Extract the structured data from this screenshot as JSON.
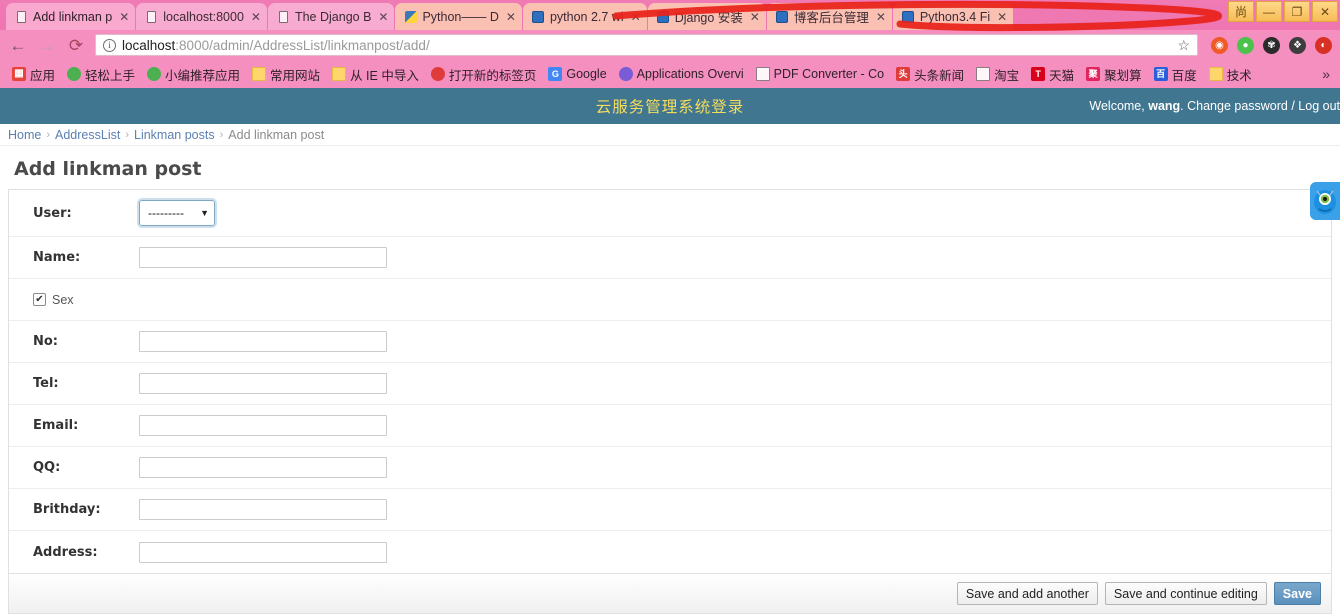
{
  "browser": {
    "tabs": [
      {
        "title": "Add linkman p",
        "favicon": "page-icon",
        "active": true
      },
      {
        "title": "localhost:8000",
        "favicon": "page-icon",
        "active": false
      },
      {
        "title": "The Django B",
        "favicon": "page-icon",
        "active": false
      },
      {
        "title": "Python—— D",
        "favicon": "python-icon",
        "active": false
      },
      {
        "title": "python 2.7 wi",
        "favicon": "app-icon",
        "active": false
      },
      {
        "title": "Django 安装",
        "favicon": "app-icon",
        "active": false
      },
      {
        "title": "博客后台管理",
        "favicon": "app-icon",
        "active": false
      },
      {
        "title": "Python3.4 Fi",
        "favicon": "app-icon",
        "active": false
      }
    ],
    "tab_close_glyph": "✕",
    "window_controls": [
      {
        "name": "shang-button",
        "glyph": "尚"
      },
      {
        "name": "minimize-button",
        "glyph": "—"
      },
      {
        "name": "maximize-button",
        "glyph": "❐"
      },
      {
        "name": "close-button",
        "glyph": "✕"
      }
    ],
    "nav": {
      "back_glyph": "←",
      "forward_glyph": "→",
      "reload_glyph": "⟳",
      "info_glyph": "i",
      "star_glyph": "☆",
      "url_host": "localhost",
      "url_path": ":8000/admin/AddressList/linkmanpost/add/",
      "url_full": "localhost:8000/admin/AddressList/linkmanpost/add/"
    },
    "extensions": [
      {
        "name": "owl-extension-icon",
        "glyph": "◉",
        "color": "#f05a28"
      },
      {
        "name": "green-dot-extension-icon",
        "glyph": "●",
        "color": "#4bc34b"
      },
      {
        "name": "gear-extension-icon",
        "glyph": "✾",
        "color": "#2b2b2b"
      },
      {
        "name": "evernote-extension-icon",
        "glyph": "❖",
        "color": "#3d3d3d"
      },
      {
        "name": "red-extension-icon",
        "glyph": "◐",
        "color": "#d93025"
      }
    ],
    "bookmarks": [
      {
        "label": "应用",
        "icon": "apps-grid-icon",
        "icon_type": "grid",
        "color": "#e8433a"
      },
      {
        "label": "轻松上手",
        "icon": "chrome-icon",
        "icon_type": "chrome",
        "color": "#4caf50"
      },
      {
        "label": "小编推荐应用",
        "icon": "chrome-icon",
        "icon_type": "chrome",
        "color": "#4caf50"
      },
      {
        "label": "常用网站",
        "icon": "folder-icon",
        "icon_type": "folder",
        "color": "#ffd66b"
      },
      {
        "label": "从 IE 中导入",
        "icon": "folder-icon",
        "icon_type": "folder",
        "color": "#ffd66b"
      },
      {
        "label": "打开新的标签页",
        "icon": "red-circle-icon",
        "icon_type": "circle",
        "color": "#e03b3b"
      },
      {
        "label": "Google",
        "icon": "google-icon",
        "icon_type": "letter",
        "glyph": "G",
        "color": "#4285f4"
      },
      {
        "label": "Applications Overvi",
        "icon": "firefox-icon",
        "icon_type": "circle",
        "color": "#7a5cd6"
      },
      {
        "label": "PDF Converter - Co",
        "icon": "pdf-icon",
        "icon_type": "doc",
        "color": "#f0a030"
      },
      {
        "label": "头条新闻",
        "icon": "toutiao-icon",
        "icon_type": "letter",
        "glyph": "头",
        "color": "#e03b3b"
      },
      {
        "label": "淘宝",
        "icon": "taobao-icon",
        "icon_type": "doc",
        "color": "#ff6a00"
      },
      {
        "label": "天猫",
        "icon": "tmall-icon",
        "icon_type": "letter",
        "glyph": "T",
        "color": "#d9001b"
      },
      {
        "label": "聚划算",
        "icon": "juhuasuan-icon",
        "icon_type": "letter",
        "glyph": "聚",
        "color": "#e0245e"
      },
      {
        "label": "百度",
        "icon": "baidu-icon",
        "icon_type": "letter",
        "glyph": "百",
        "color": "#2b5fd9"
      },
      {
        "label": "技术",
        "icon": "folder-icon",
        "icon_type": "folder",
        "color": "#ffd66b"
      }
    ],
    "bookmarks_overflow_glyph": "»"
  },
  "admin": {
    "branding": "云服务管理系统登录",
    "user_tools": {
      "welcome_prefix": "Welcome, ",
      "username": "wang",
      "suffix": ". Change password / Log out"
    },
    "breadcrumbs": [
      {
        "label": "Home",
        "link": true
      },
      {
        "label": "AddressList",
        "link": true
      },
      {
        "label": "Linkman posts",
        "link": true
      },
      {
        "label": "Add linkman post",
        "link": false
      }
    ],
    "breadcrumb_separator": "›",
    "page_title": "Add linkman post",
    "form": {
      "fields": [
        {
          "label": "User:",
          "type": "select",
          "value": "---------",
          "caret": "▼",
          "name": "user"
        },
        {
          "label": "Name:",
          "type": "text",
          "value": "",
          "name": "name"
        },
        {
          "label": "Sex",
          "type": "checkbox",
          "checked": true,
          "check_glyph": "✔",
          "name": "sex"
        },
        {
          "label": "No:",
          "type": "text",
          "value": "",
          "name": "no"
        },
        {
          "label": "Tel:",
          "type": "text",
          "value": "",
          "name": "tel"
        },
        {
          "label": "Email:",
          "type": "text",
          "value": "",
          "name": "email"
        },
        {
          "label": "QQ:",
          "type": "text",
          "value": "",
          "name": "qq"
        },
        {
          "label": "Brithday:",
          "type": "text",
          "value": "",
          "name": "brithday"
        },
        {
          "label": "Address:",
          "type": "text",
          "value": "",
          "name": "address"
        }
      ]
    },
    "submit_row": {
      "save_and_add_another": "Save and add another",
      "save_and_continue": "Save and continue editing",
      "save": "Save"
    },
    "floating_widget": {
      "name": "monster-assistant-icon",
      "color": "#3aa0e8"
    }
  },
  "colors": {
    "header_bg": "#417690",
    "branding_text": "#f5dd5d",
    "breadcrumb_link": "#5b80b2",
    "chrome_tint": "#f48fc0",
    "annotation_red": "#e8211a",
    "save_button": "#5b90bd"
  }
}
